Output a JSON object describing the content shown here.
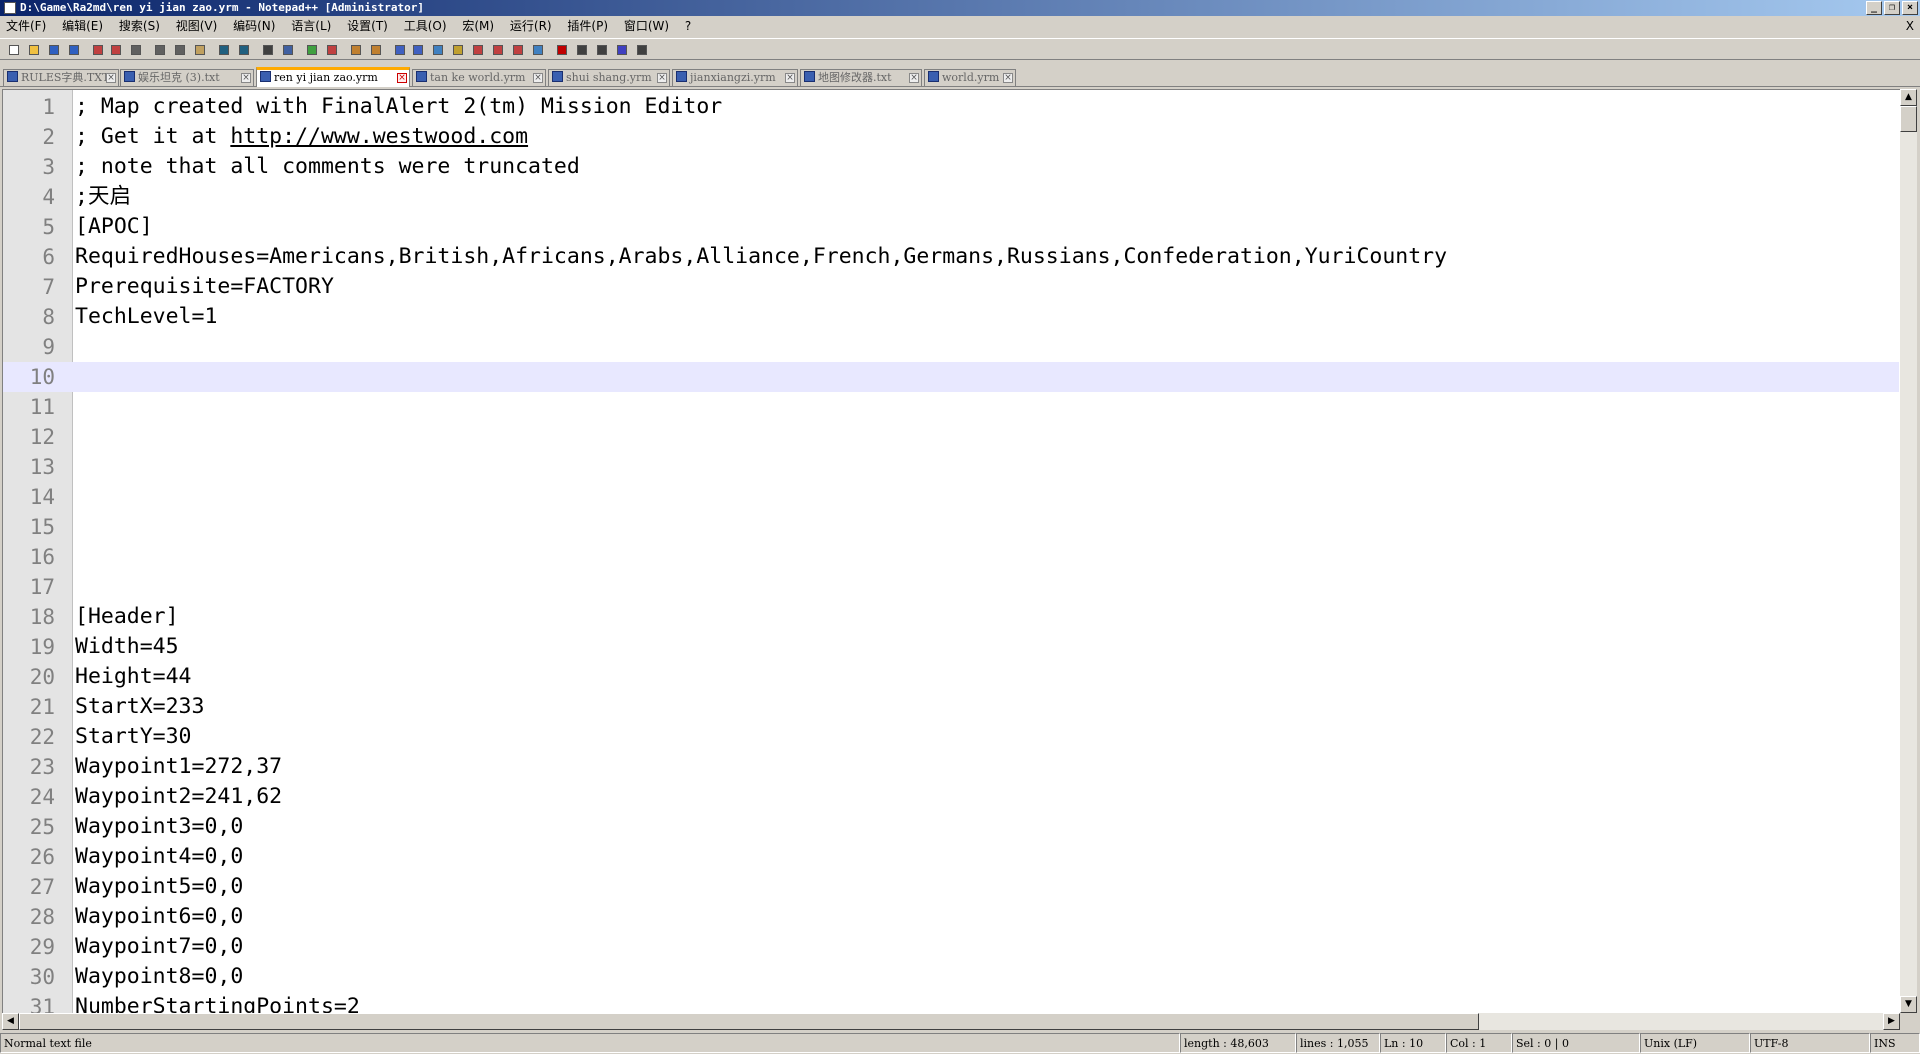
{
  "window": {
    "title": "D:\\Game\\Ra2md\\ren yi jian zao.yrm - Notepad++ [Administrator]"
  },
  "menu": [
    "文件(F)",
    "编辑(E)",
    "搜索(S)",
    "视图(V)",
    "编码(N)",
    "语言(L)",
    "设置(T)",
    "工具(O)",
    "宏(M)",
    "运行(R)",
    "插件(P)",
    "窗口(W)",
    "?"
  ],
  "menu_close": "X",
  "tabs": [
    {
      "label": "RULES字典.TXT",
      "active": false
    },
    {
      "label": "娱乐坦克 (3).txt",
      "active": false
    },
    {
      "label": "ren yi jian zao.yrm",
      "active": true
    },
    {
      "label": "tan ke world.yrm",
      "active": false
    },
    {
      "label": "shui shang.yrm",
      "active": false
    },
    {
      "label": "jianxiangzi.yrm",
      "active": false
    },
    {
      "label": "地图修改器.txt",
      "active": false
    },
    {
      "label": "world.yrm",
      "active": false
    }
  ],
  "editor": {
    "current_line": 10,
    "lines": [
      {
        "n": "1",
        "text": "; Map created with FinalAlert 2(tm) Mission Editor"
      },
      {
        "n": "2",
        "pre": "; Get it at ",
        "url": "http://www.westwood.com"
      },
      {
        "n": "3",
        "text": "; note that all comments were truncated"
      },
      {
        "n": "4",
        "text": ";天启"
      },
      {
        "n": "5",
        "text": "[APOC]"
      },
      {
        "n": "6",
        "text": "RequiredHouses=Americans,British,Africans,Arabs,Alliance,French,Germans,Russians,Confederation,YuriCountry"
      },
      {
        "n": "7",
        "text": "Prerequisite=FACTORY"
      },
      {
        "n": "8",
        "text": "TechLevel=1"
      },
      {
        "n": "9",
        "text": ""
      },
      {
        "n": "10",
        "text": ""
      },
      {
        "n": "11",
        "text": ""
      },
      {
        "n": "12",
        "text": ""
      },
      {
        "n": "13",
        "text": ""
      },
      {
        "n": "14",
        "text": ""
      },
      {
        "n": "15",
        "text": ""
      },
      {
        "n": "16",
        "text": ""
      },
      {
        "n": "17",
        "text": ""
      },
      {
        "n": "18",
        "text": "[Header]"
      },
      {
        "n": "19",
        "text": "Width=45"
      },
      {
        "n": "20",
        "text": "Height=44"
      },
      {
        "n": "21",
        "text": "StartX=233"
      },
      {
        "n": "22",
        "text": "StartY=30"
      },
      {
        "n": "23",
        "text": "Waypoint1=272,37"
      },
      {
        "n": "24",
        "text": "Waypoint2=241,62"
      },
      {
        "n": "25",
        "text": "Waypoint3=0,0"
      },
      {
        "n": "26",
        "text": "Waypoint4=0,0"
      },
      {
        "n": "27",
        "text": "Waypoint5=0,0"
      },
      {
        "n": "28",
        "text": "Waypoint6=0,0"
      },
      {
        "n": "29",
        "text": "Waypoint7=0,0"
      },
      {
        "n": "30",
        "text": "Waypoint8=0,0"
      },
      {
        "n": "31",
        "text": "NumberStartingPoints=2"
      }
    ]
  },
  "status": {
    "file_type": "Normal text file",
    "length": "length : 48,603",
    "lines": "lines : 1,055",
    "ln": "Ln : 10",
    "col": "Col : 1",
    "sel": "Sel : 0 | 0",
    "eol": "Unix (LF)",
    "encoding": "UTF-8",
    "mode": "INS"
  },
  "toolbar_icons": [
    "new-file-icon",
    "open-file-icon",
    "save-icon",
    "save-all-icon",
    "close-icon",
    "close-all-icon",
    "print-icon",
    "cut-icon",
    "copy-icon",
    "paste-icon",
    "undo-icon",
    "redo-icon",
    "find-icon",
    "replace-icon",
    "zoom-in-icon",
    "zoom-out-icon",
    "sync-v-icon",
    "sync-h-icon",
    "word-wrap-icon",
    "show-all-chars-icon",
    "indent-guide-icon",
    "doc-map-icon",
    "function-list-icon",
    "folder-workspace-icon",
    "doc-list-icon",
    "monitoring-icon",
    "record-macro-icon",
    "stop-record-icon",
    "play-macro-icon",
    "run-macro-multiple-icon",
    "save-macro-icon"
  ]
}
